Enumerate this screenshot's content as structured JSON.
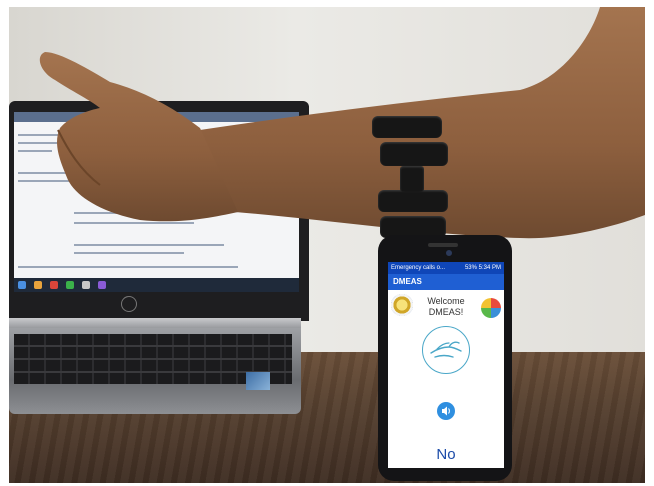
{
  "phone": {
    "status_left": "Emergency calls o...",
    "status_right": "53% 5:34 PM",
    "app_title": "DMEAS",
    "welcome_line1": "Welcome",
    "welcome_line2": "DMEAS!",
    "answer": "No",
    "icons": [
      "institution-logo-icon",
      "app-logo-icon",
      "wave-gesture-icon",
      "speaker-icon"
    ],
    "colors": {
      "status_bar": "#0f46b8",
      "app_bar": "#1f5fd3",
      "speaker_button": "#2f8fe0",
      "answer_text": "#1a4aa8"
    }
  },
  "scene": {
    "objects": [
      "laptop",
      "arm-with-armband",
      "smartphone",
      "wooden-desk"
    ]
  }
}
